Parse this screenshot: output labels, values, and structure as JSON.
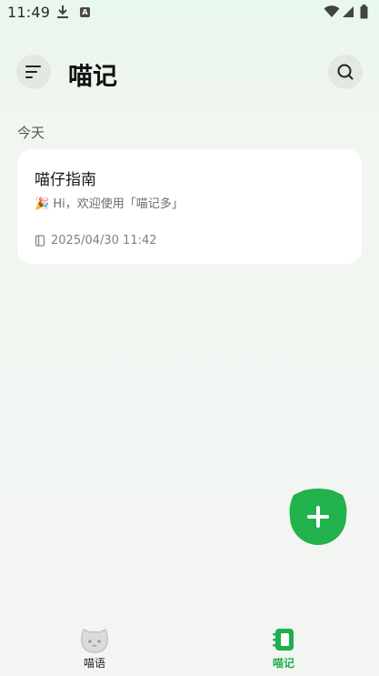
{
  "status_bar": {
    "time": "11:49",
    "a_badge": "A"
  },
  "header": {
    "title": "喵记"
  },
  "section": {
    "label": "今天"
  },
  "note": {
    "title": "喵仔指南",
    "preview": "🎉 Hi，欢迎使用「喵记多」",
    "date": "2025/04/30 11:42"
  },
  "bottom_nav": {
    "items": [
      {
        "label": "喵语",
        "active": false
      },
      {
        "label": "喵记",
        "active": true
      }
    ]
  },
  "colors": {
    "accent": "#1fae4b",
    "fab": "#22b24c"
  }
}
